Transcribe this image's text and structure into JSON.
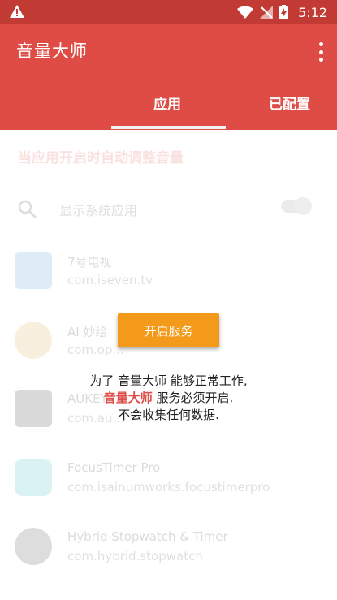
{
  "status_bar": {
    "time": "5:12"
  },
  "app_bar": {
    "title": "音量大师",
    "tabs": [
      {
        "label": "应用",
        "selected": true
      },
      {
        "label": "已配置",
        "selected": false
      }
    ]
  },
  "content": {
    "hint": "当应用开启时自动调整音量",
    "search_label": "显示系统应用",
    "apps": [
      {
        "name": "7号电视",
        "package": "com.iseven.tv"
      },
      {
        "name": "AI 妙绘",
        "package": "com.op..."
      },
      {
        "name": "AUKEY",
        "package": "com.au..."
      },
      {
        "name": "FocusTimer Pro",
        "package": "com.isainumworks.focustimerpro"
      },
      {
        "name": "Hybrid Stopwatch & Timer",
        "package": "com.hybrid.stopwatch"
      }
    ]
  },
  "dialog": {
    "button_label": "开启服务",
    "line1": "为了 音量大师 能够正常工作,",
    "line2_highlight": "音量大师",
    "line2_rest": " 服务必须开启.",
    "line3": "不会收集任何数据."
  },
  "colors": {
    "primary": "#de4c45",
    "status_bar": "#c23a34",
    "accent": "#f39a1a"
  }
}
